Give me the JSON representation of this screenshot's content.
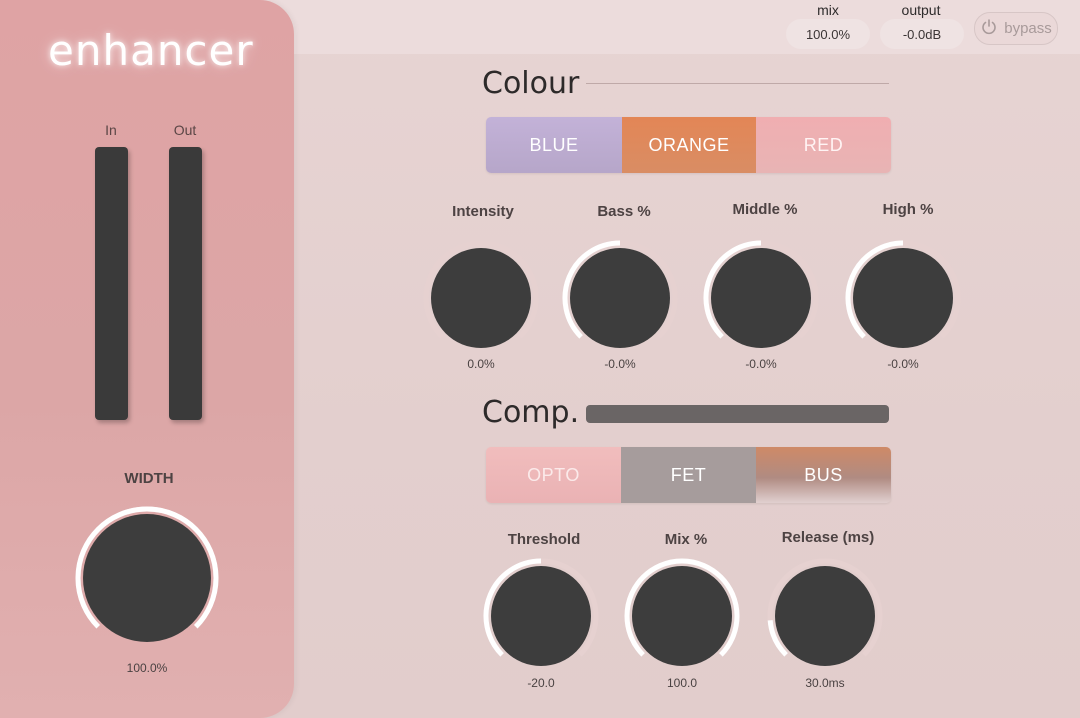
{
  "app": {
    "title": "enhancer"
  },
  "top": {
    "mix": {
      "label": "mix",
      "value": "100.0%"
    },
    "output": {
      "label": "output",
      "value": "-0.0dB"
    },
    "bypass_label": "bypass"
  },
  "side": {
    "meter_in_label": "In",
    "meter_out_label": "Out",
    "width": {
      "label": "WIDTH",
      "value": "100.0%",
      "level": 1.0
    }
  },
  "colour": {
    "title": "Colour",
    "modes": [
      "BLUE",
      "ORANGE",
      "RED"
    ],
    "selected": "ORANGE",
    "knobs": [
      {
        "label": "Intensity",
        "value": "0.0%",
        "level": 0.0
      },
      {
        "label": "Bass %",
        "value": "-0.0%",
        "level": 0.5
      },
      {
        "label": "Middle %",
        "value": "-0.0%",
        "level": 0.5
      },
      {
        "label": "High %",
        "value": "-0.0%",
        "level": 0.5
      }
    ]
  },
  "comp": {
    "title": "Comp.",
    "modes": [
      "OPTO",
      "FET",
      "BUS"
    ],
    "selected": "BUS",
    "knobs": [
      {
        "label": "Threshold",
        "value": "-20.0",
        "level": 0.5
      },
      {
        "label": "Mix %",
        "value": "100.0",
        "level": 1.0
      },
      {
        "label": "Release (ms)",
        "value": "30.0ms",
        "level": 0.15
      }
    ]
  },
  "colors": {
    "knob_body": "#3d3d3d",
    "arc_fill": "#ffffff",
    "arc_track": "#e6d1d0",
    "blue": "#bba9d0",
    "orange": "#e18a57",
    "red": "#efb0b2",
    "opto": "#efb9b9",
    "fet": "#a89e9e",
    "bus": "#c8927c"
  }
}
